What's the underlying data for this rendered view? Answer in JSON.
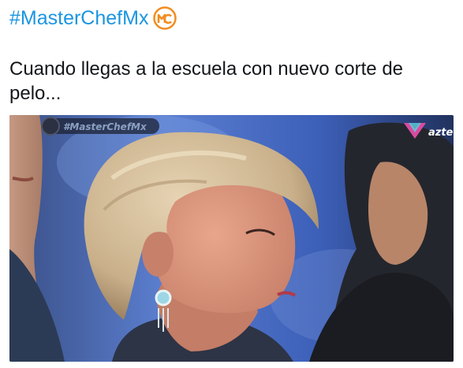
{
  "tweet": {
    "hashtag": "#MasterChefMx",
    "text": "Cuando llegas a la escuela con nuevo corte de pelo..."
  },
  "media": {
    "overlay_hashtag": "#MasterChefMx",
    "network_logo_text": "azte"
  },
  "icons": {
    "hashtag_emoji": "masterchef-logo-icon",
    "network_logo": "azteca-logo-icon"
  },
  "colors": {
    "hashtag_blue": "#1b95e0",
    "text": "#14171a",
    "mc_orange": "#f28c1e"
  }
}
